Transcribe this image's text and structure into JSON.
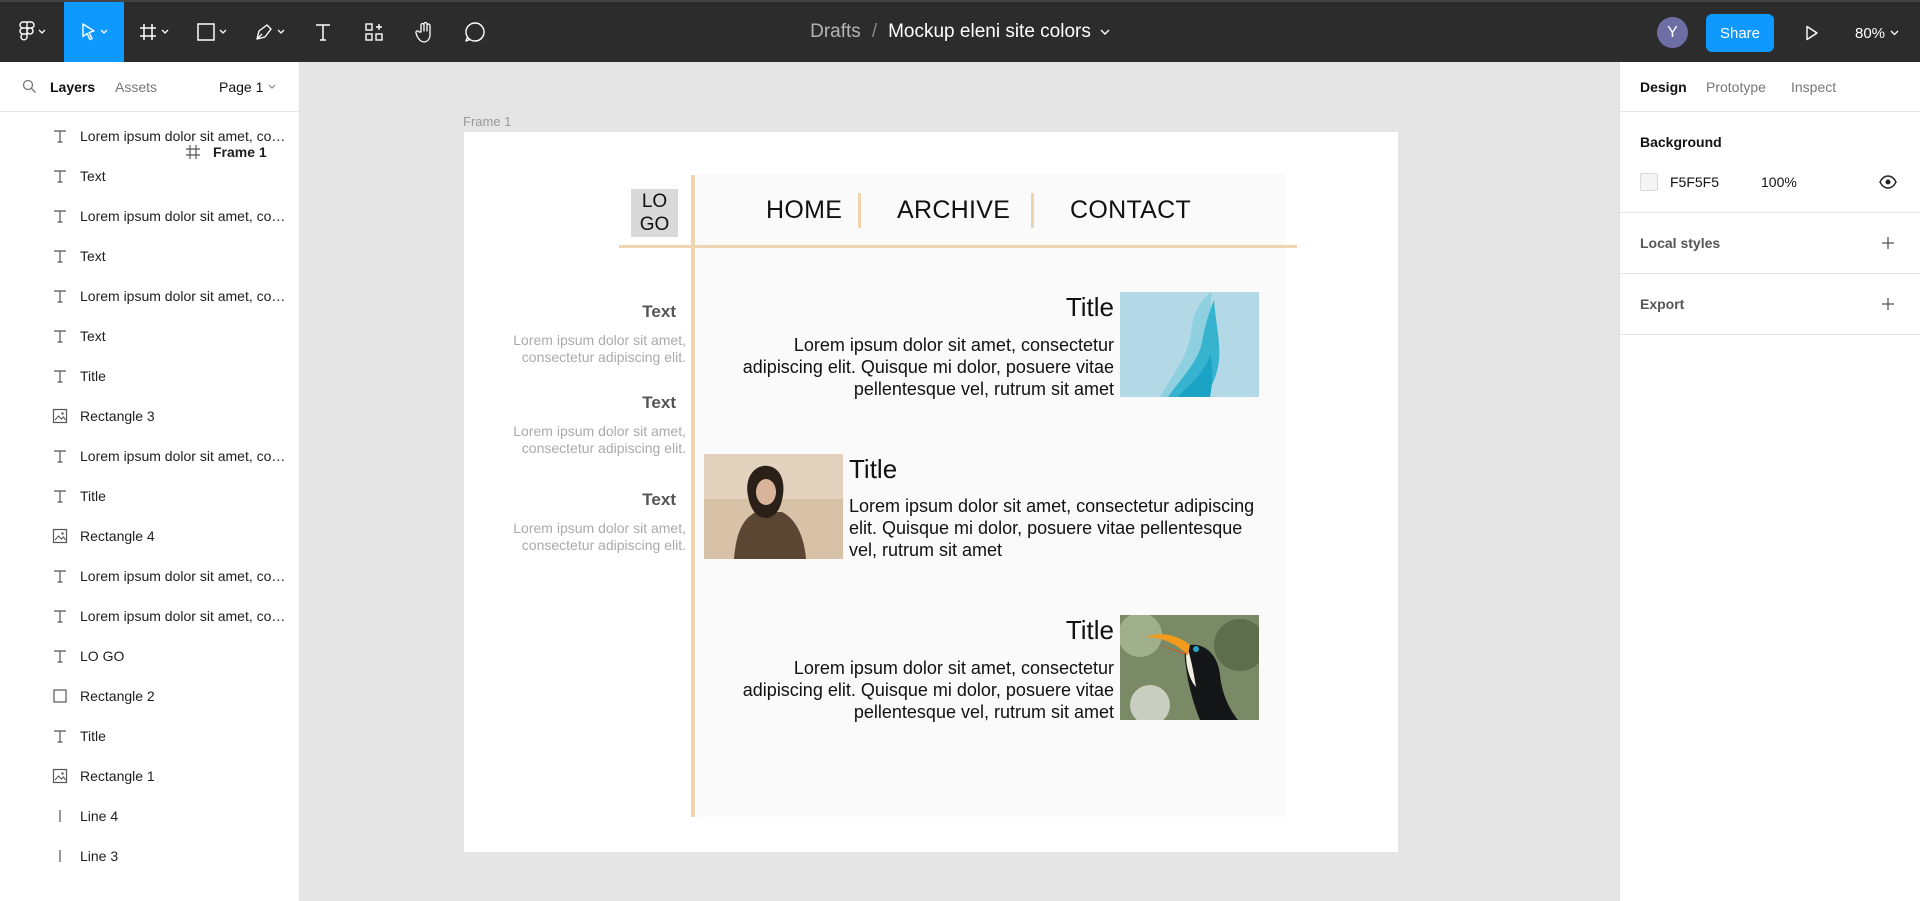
{
  "toolbar": {
    "tools": [
      {
        "name": "main-menu",
        "icon": "figma-logo-icon"
      },
      {
        "name": "move",
        "icon": "cursor-icon",
        "active": true
      },
      {
        "name": "frame",
        "icon": "frame-icon"
      },
      {
        "name": "shape",
        "icon": "rectangle-icon"
      },
      {
        "name": "pen",
        "icon": "pen-icon"
      },
      {
        "name": "text",
        "icon": "text-icon"
      },
      {
        "name": "resources",
        "icon": "components-icon"
      },
      {
        "name": "hand",
        "icon": "hand-icon"
      },
      {
        "name": "comment",
        "icon": "comment-icon"
      }
    ],
    "breadcrumb": {
      "folder": "Drafts",
      "separator": "/",
      "file": "Mockup eleni site colors"
    },
    "avatar_initial": "Y",
    "share_label": "Share",
    "zoom": "80%"
  },
  "left_panel": {
    "tabs": {
      "layers": "Layers",
      "assets": "Assets"
    },
    "page": "Page 1",
    "frame": {
      "name": "Frame 1"
    },
    "layers": [
      {
        "type": "text",
        "name": "Lorem ipsum dolor sit amet, consectetur adipiscing elit."
      },
      {
        "type": "text",
        "name": "Text"
      },
      {
        "type": "text",
        "name": "Lorem ipsum dolor sit amet, consectetur adipiscing elit."
      },
      {
        "type": "text",
        "name": "Text"
      },
      {
        "type": "text",
        "name": "Lorem ipsum dolor sit amet, consectetur adipiscing elit."
      },
      {
        "type": "text",
        "name": "Text"
      },
      {
        "type": "text",
        "name": "Title"
      },
      {
        "type": "image",
        "name": "Rectangle 3"
      },
      {
        "type": "text",
        "name": "Lorem ipsum dolor sit amet, consectetur adipiscing elit."
      },
      {
        "type": "text",
        "name": "Title"
      },
      {
        "type": "image",
        "name": "Rectangle 4"
      },
      {
        "type": "text",
        "name": "Lorem ipsum dolor sit amet, consectetur adipiscing elit."
      },
      {
        "type": "text",
        "name": "Lorem ipsum dolor sit amet, consectetur adipiscing elit."
      },
      {
        "type": "text",
        "name": "LO GO"
      },
      {
        "type": "rect",
        "name": "Rectangle 2"
      },
      {
        "type": "text",
        "name": "Title"
      },
      {
        "type": "image",
        "name": "Rectangle 1"
      },
      {
        "type": "line",
        "name": "Line 4"
      },
      {
        "type": "line",
        "name": "Line 3"
      }
    ]
  },
  "right_panel": {
    "tabs": {
      "design": "Design",
      "prototype": "Prototype",
      "inspect": "Inspect"
    },
    "background": {
      "label": "Background",
      "hex": "F5F5F5",
      "opacity": "100%",
      "swatch": "#F5F5F5"
    },
    "local_styles": "Local styles",
    "export": "Export"
  },
  "canvas": {
    "frame_label": "Frame 1",
    "mockup": {
      "logo": {
        "line1": "LO",
        "line2": "GO"
      },
      "nav": [
        "HOME",
        "ARCHIVE",
        "CONTACT"
      ],
      "accent_color": "#F0D4B0",
      "sidebar": [
        {
          "title": "Text",
          "text": "Lorem ipsum dolor sit amet, consectetur adipiscing elit."
        },
        {
          "title": "Text",
          "text": "Lorem ipsum dolor sit amet, consectetur adipiscing elit."
        },
        {
          "title": "Text",
          "text": "Lorem ipsum dolor sit amet, consectetur adipiscing elit."
        }
      ],
      "cards": [
        {
          "title": "Title",
          "body": "Lorem ipsum dolor sit amet, consectetur adipiscing elit. Quisque mi dolor, posuere vitae pellentesque vel, rutrum sit amet",
          "image": "abstract-blue-wave"
        },
        {
          "title": "Title",
          "body": "Lorem ipsum dolor sit amet, consectetur adipiscing elit. Quisque mi dolor, posuere vitae pellentesque vel, rutrum sit amet",
          "image": "woman-portrait"
        },
        {
          "title": "Title",
          "body": "Lorem ipsum dolor sit amet, consectetur adipiscing elit. Quisque mi dolor, posuere vitae pellentesque vel, rutrum sit amet",
          "image": "toucan-bird"
        }
      ]
    }
  }
}
